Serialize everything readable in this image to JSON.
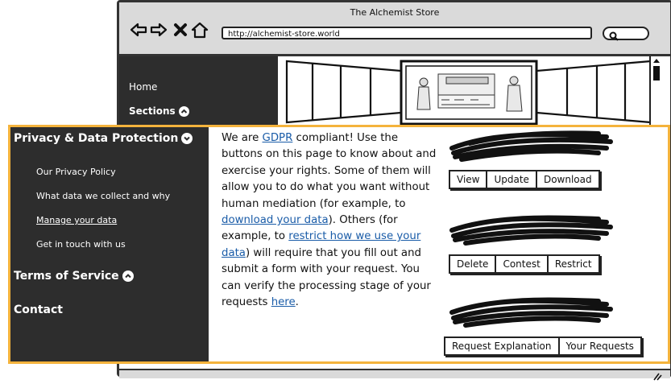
{
  "browser": {
    "title": "The Alchemist Store",
    "url": "http://alchemist-store.world",
    "nav_icons": [
      "back-arrow-icon",
      "forward-arrow-icon",
      "close-x-icon",
      "home-icon",
      "search-icon"
    ]
  },
  "top_nav": {
    "home": "Home",
    "sections": "Sections"
  },
  "sidebar": {
    "privacy_heading": "Privacy & Data Protection",
    "items": [
      {
        "label": "Our Privacy Policy"
      },
      {
        "label": "What data we collect and why"
      },
      {
        "label": "Manage your data"
      },
      {
        "label": "Get in touch with us"
      }
    ],
    "terms_heading": "Terms of Service",
    "contact_heading": "Contact"
  },
  "content": {
    "p1": "We are ",
    "gdpr_link": "GDPR",
    "p2": " compliant! Use the buttons on this page to know about and exercise your rights. Some of them will allow you to do what you want without human mediation (for example, to ",
    "download_link": "download your data",
    "p3": "). Others (for example, to ",
    "restrict_link": "restrict how we use your data",
    "p4": ") will require that you fill out and submit a form with your request. You can verify the processing stage of your requests ",
    "here_link": "here",
    "p5": "."
  },
  "button_groups": {
    "group1": {
      "view": "View",
      "update": "Update",
      "download": "Download"
    },
    "group2": {
      "delete": "Delete",
      "contest": "Contest",
      "restrict": "Restrict"
    },
    "group3": {
      "request_explanation": "Request Explanation",
      "your_requests": "Your Requests"
    }
  },
  "colors": {
    "sidebar_bg": "#2d2d2d",
    "highlight_border": "#f4b33c",
    "link": "#1a5ca8",
    "chrome": "#dadada"
  }
}
